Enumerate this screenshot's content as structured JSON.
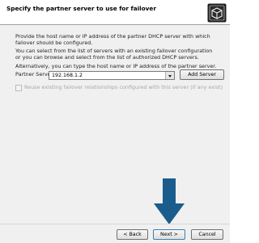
{
  "header": {
    "title": "Specify the partner server to use for failover",
    "icon": "server-wizard-icon"
  },
  "content": {
    "intro": "Provide the host name or IP address of the partner DHCP server with which failover should be configured.",
    "select_hint": "You can select from the list of servers with an existing failover configuration or you can browse and select from the list of authorized DHCP servers.",
    "type_hint": "Alternatively, you can type the host name or IP address of the partner server.",
    "partner_label": "Partner Server:",
    "partner_value": "192.168.1.2",
    "add_server_label": "Add Server",
    "reuse_label": "Reuse existing failover relationships configured with this server (if any exist)",
    "reuse_checked": false
  },
  "footer": {
    "back_label": "< Back",
    "next_label": "Next >",
    "cancel_label": "Cancel"
  },
  "colors": {
    "annotation_arrow": "#1a5d8c"
  }
}
